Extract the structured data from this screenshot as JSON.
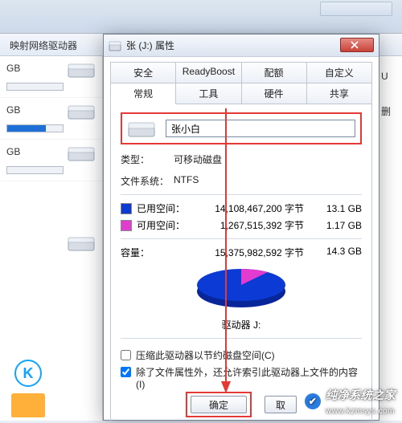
{
  "background": {
    "toolbar_label": "映射网络驱动器",
    "drive_stubs": [
      {
        "gb": "GB",
        "fill": 0
      },
      {
        "gb": "GB",
        "fill": 70
      },
      {
        "gb": "GB",
        "fill": 0
      }
    ],
    "right_clip": {
      "l1": "U",
      "l2": "删"
    },
    "k_label": "K"
  },
  "dialog": {
    "title": "张 (J:) 属性",
    "tabs_top": [
      "安全",
      "ReadyBoost",
      "配额",
      "自定义"
    ],
    "tabs_bottom": [
      "常规",
      "工具",
      "硬件",
      "共享"
    ],
    "active_tab": "常规",
    "name_value": "张小白",
    "type_label": "类型：",
    "type_value": "可移动磁盘",
    "fs_label": "文件系统：",
    "fs_value": "NTFS",
    "used_label": "已用空间：",
    "used_bytes": "14,108,467,200 字节",
    "used_gb": "13.1 GB",
    "free_label": "可用空间：",
    "free_bytes": "1,267,515,392 字节",
    "free_gb": "1.17 GB",
    "cap_label": "容量：",
    "cap_bytes": "15,375,982,592 字节",
    "cap_gb": "14.3 GB",
    "drive_letter": "驱动器 J:",
    "opt_compress": "压缩此驱动器以节约磁盘空间(C)",
    "opt_index": "除了文件属性外，还允许索引此驱动器上文件的内容(I)",
    "opt_index_checked": true,
    "ok_label": "确定",
    "cancel_label": "取"
  },
  "watermark": {
    "text": "纯净系统之家",
    "url": "www.kzmsys.com"
  },
  "chart_data": {
    "type": "pie",
    "title": "",
    "series": [
      {
        "name": "已用空间",
        "value": 14108467200,
        "color": "#0b3bd4"
      },
      {
        "name": "可用空间",
        "value": 1267515392,
        "color": "#e23bcf"
      }
    ]
  }
}
